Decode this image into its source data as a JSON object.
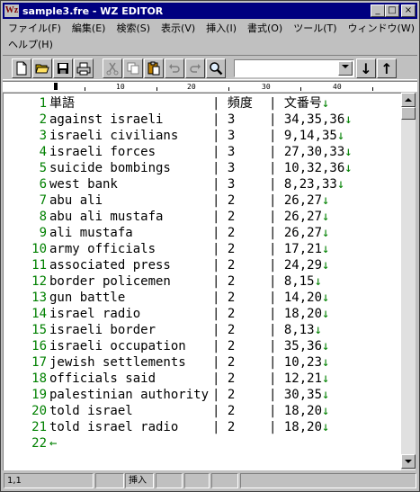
{
  "window": {
    "title": "sample3.fre - WZ EDITOR",
    "icon_text": "Wz",
    "controls": {
      "minimize": "_",
      "maximize": "□",
      "close": "×"
    }
  },
  "menu": {
    "row1": [
      "ファイル(F)",
      "編集(E)",
      "検索(S)",
      "表示(V)",
      "挿入(I)",
      "書式(O)",
      "ツール(T)",
      "ウィンドウ(W)"
    ],
    "row2": [
      "ヘルプ(H)"
    ]
  },
  "toolbar": {
    "buttons": [
      "new-file",
      "open-folder",
      "save",
      "print",
      "cut",
      "copy",
      "paste",
      "undo",
      "redo",
      "search"
    ],
    "search_value": "",
    "down_arrow": "↓",
    "up_arrow": "↑"
  },
  "ruler": {
    "marks": [
      "10",
      "20",
      "30",
      "40"
    ]
  },
  "editor": {
    "lines": [
      {
        "n": "1",
        "c1": "単語",
        "c2": "| 頻度",
        "c3": "| 文番号",
        "eol": "↓"
      },
      {
        "n": "2",
        "c1": "against israeli",
        "c2": "| 3",
        "c3": "| 34,35,36",
        "eol": "↓"
      },
      {
        "n": "3",
        "c1": "israeli civilians",
        "c2": "| 3",
        "c3": "| 9,14,35",
        "eol": "↓"
      },
      {
        "n": "4",
        "c1": "israeli forces",
        "c2": "| 3",
        "c3": "| 27,30,33",
        "eol": "↓"
      },
      {
        "n": "5",
        "c1": "suicide bombings",
        "c2": "| 3",
        "c3": "| 10,32,36",
        "eol": "↓"
      },
      {
        "n": "6",
        "c1": "west bank",
        "c2": "| 3",
        "c3": "| 8,23,33",
        "eol": "↓"
      },
      {
        "n": "7",
        "c1": "abu ali",
        "c2": "| 2",
        "c3": "| 26,27",
        "eol": "↓"
      },
      {
        "n": "8",
        "c1": "abu ali mustafa",
        "c2": "| 2",
        "c3": "| 26,27",
        "eol": "↓"
      },
      {
        "n": "9",
        "c1": "ali mustafa",
        "c2": "| 2",
        "c3": "| 26,27",
        "eol": "↓"
      },
      {
        "n": "10",
        "c1": "army officials",
        "c2": "| 2",
        "c3": "| 17,21",
        "eol": "↓"
      },
      {
        "n": "11",
        "c1": "associated press",
        "c2": "| 2",
        "c3": "| 24,29",
        "eol": "↓"
      },
      {
        "n": "12",
        "c1": "border policemen",
        "c2": "| 2",
        "c3": "| 8,15",
        "eol": "↓"
      },
      {
        "n": "13",
        "c1": "gun battle",
        "c2": "| 2",
        "c3": "| 14,20",
        "eol": "↓"
      },
      {
        "n": "14",
        "c1": "israel radio",
        "c2": "| 2",
        "c3": "| 18,20",
        "eol": "↓"
      },
      {
        "n": "15",
        "c1": "israeli border",
        "c2": "| 2",
        "c3": "| 8,13",
        "eol": "↓"
      },
      {
        "n": "16",
        "c1": "israeli occupation",
        "c2": "| 2",
        "c3": "| 35,36",
        "eol": "↓"
      },
      {
        "n": "17",
        "c1": "jewish settlements",
        "c2": "| 2",
        "c3": "| 10,23",
        "eol": "↓"
      },
      {
        "n": "18",
        "c1": "officials said",
        "c2": "| 2",
        "c3": "| 12,21",
        "eol": "↓"
      },
      {
        "n": "19",
        "c1": "palestinian authority",
        "c2": "| 2",
        "c3": "| 30,35",
        "eol": "↓"
      },
      {
        "n": "20",
        "c1": "told israel",
        "c2": "| 2",
        "c3": "| 18,20",
        "eol": "↓"
      },
      {
        "n": "21",
        "c1": "told israel radio",
        "c2": "| 2",
        "c3": "| 18,20",
        "eol": "↓"
      },
      {
        "n": "22",
        "c1": "",
        "c2": "",
        "c3": "",
        "eol": "←"
      }
    ]
  },
  "status": {
    "position": "1,1",
    "mode": "挿入"
  },
  "colors": {
    "titlebar": "#000080",
    "line_numbers": "#008000",
    "face": "#c0c0c0"
  }
}
